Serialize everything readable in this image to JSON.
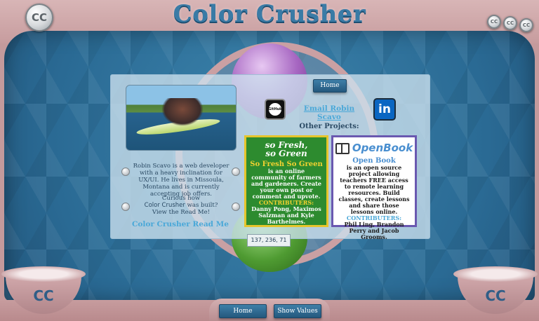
{
  "title": "Color Crusher",
  "logo_text": "CC",
  "corner_coins": [
    "CC",
    "CC",
    "CC"
  ],
  "bowls": [
    "CC",
    "CC"
  ],
  "panel": {
    "home_label": "Home",
    "bio_text": "Robin Scavo is a web developer with a heavy inclination for UX/UI. He lives in Missoula, Montana and is currently accepting job offers.",
    "curious_line1": "Curious how",
    "curious_line2": "Color Crusher",
    "curious_line3": "was built?",
    "curious_line4": "View the Read Me!",
    "readme_link": "Color Crusher Read Me",
    "email_link": "Email Robin Scavo",
    "github_icon_text": "GitHub",
    "linkedin_icon_text": "in",
    "other_projects": "Other Projects:"
  },
  "projects": [
    {
      "logo_line1": "so Fresh,",
      "logo_line2": "so Green",
      "title": "So Fresh So Green",
      "description": "is an online community of farmers and gardeners. Create your own post or comment and upvote.",
      "contributors_heading": "CONTRIBUTERS:",
      "contributors": "Danny Pong, Maximos Salzman and Kyle Barthelmes."
    },
    {
      "logo": "OpenBook",
      "title": "Open Book",
      "description": "is an open source project allowing teachers FREE access to remote learning resources. Build classes, create lessons and share those lessons online.",
      "contributors_heading": "CONTRIBUTERS:",
      "contributors": "Phil Ling, Brandon Perry and Jacob Grooms."
    }
  ],
  "rgb_value": "137, 236, 71",
  "bottom_bar": {
    "home_label": "Home",
    "show_values_label": "Show Values"
  },
  "colors": {
    "board": "#2a6a94",
    "frame": "#c49a9c",
    "green_card": "#2d8b2f",
    "green_card_border": "#e6c52c",
    "purple_card_border": "#6a58b0",
    "link": "#4aa8d8",
    "contributors_highlight": "#f3d230"
  }
}
